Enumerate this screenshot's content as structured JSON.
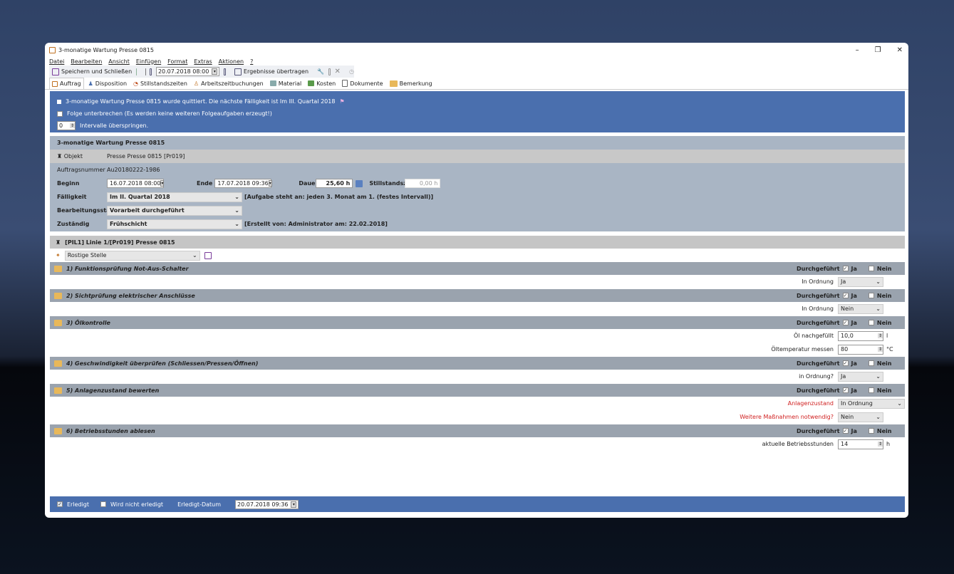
{
  "window": {
    "title": "3-monatige Wartung Presse 0815",
    "controls": [
      "–",
      "❐",
      "✕"
    ]
  },
  "menu": [
    "Datei",
    "Bearbeiten",
    "Ansicht",
    "Einfügen",
    "Format",
    "Extras",
    "Aktionen",
    "?"
  ],
  "toolbar": {
    "save_close": "Speichern und Schließen",
    "date": "20.07.2018 08:00",
    "transfer": "Ergebnisse übertragen"
  },
  "tabs": [
    "Auftrag",
    "Disposition",
    "Stillstandszeiten",
    "Arbeitszeitbuchungen",
    "Material",
    "Kosten",
    "Dokumente",
    "Bemerkung"
  ],
  "notice": {
    "quittiert": "3-monatige Wartung Presse 0815 wurde quittiert. Die nächste Fälligkeit ist Im III. Quartal 2018",
    "folge": "Folge unterbrechen (Es werden keine weiteren Folgeaufgaben erzeugt!)",
    "intervalle_value": "0",
    "intervalle_label": "Intervalle überspringen."
  },
  "order": {
    "header": "3-monatige Wartung Presse 0815",
    "objekt_label": "Objekt",
    "objekt": "Presse Presse 0815 [Pr019]",
    "nr_label": "Auftragsnummer",
    "nr": "Au20180222-1986",
    "beginn_label": "Beginn",
    "beginn": "16.07.2018 08:00",
    "ende_label": "Ende",
    "ende": "17.07.2018 09:36",
    "dauer_label": "Dauer",
    "dauer": "25,60 h",
    "still_label": "Stillstandszeit",
    "still": "0,00 h",
    "faell_label": "Fälligkeit",
    "faell": "Im II. Quartal 2018",
    "faell_note": "[Aufgabe steht an: jeden 3. Monat am 1.  (festes Intervall)]",
    "status_label": "Bearbeitungsstatus",
    "status": "Vorarbeit durchgeführt",
    "zust_label": "Zuständig",
    "zust": "Frühschicht",
    "zust_note": "[Erstellt von: Administrator am: 22.02.2018]"
  },
  "line": "[PIL1] Linie 1/[Pr019] Presse 0815",
  "rostige": "Rostige Stelle",
  "labels": {
    "durch": "Durchgeführt",
    "ja": "Ja",
    "nein": "Nein"
  },
  "tasks": [
    {
      "title": "1) Funktionsprüfung Not-Aus-Schalter",
      "fields": [
        {
          "label": "In Ordnung",
          "value": "Ja"
        }
      ]
    },
    {
      "title": "2) Sichtprüfung elektrischer Anschlüsse",
      "fields": [
        {
          "label": "In Ordnung",
          "value": "Nein"
        }
      ]
    },
    {
      "title": "3) Ölkontrolle",
      "fields": [
        {
          "label": "Öl nachgefüllt",
          "value": "10,0",
          "unit": "l"
        },
        {
          "label": "Öltemperatur messen",
          "value": "80",
          "unit": "°C"
        }
      ]
    },
    {
      "title": "4) Geschwindigkeit überprüfen (Schliessen/Pressen/Öffnen)",
      "fields": [
        {
          "label": "in Ordnung?",
          "value": "Ja"
        }
      ]
    },
    {
      "title": "5) Anlagenzustand bewerten",
      "fields": [
        {
          "label": "Anlagenzustand",
          "value": "In Ordnung"
        },
        {
          "label": "Weitere Maßnahmen notwendig?",
          "value": "Nein"
        }
      ]
    },
    {
      "title": "6) Betriebsstunden ablesen",
      "fields": [
        {
          "label": "aktuelle Betriebsstunden",
          "value": "14",
          "unit": "h"
        }
      ]
    }
  ],
  "footer": {
    "erledigt": "Erledigt",
    "nicht": "Wird nicht erledigt",
    "datum_label": "Erledigt-Datum",
    "datum": "20.07.2018 09:36"
  }
}
